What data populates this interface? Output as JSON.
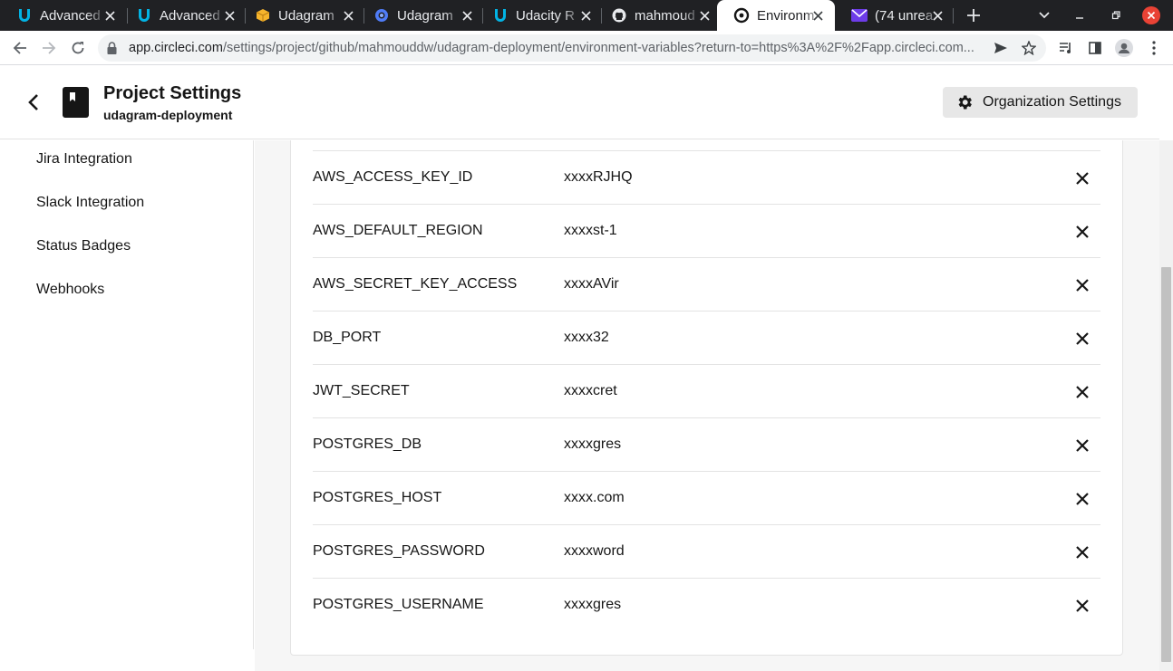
{
  "browser": {
    "tabs": [
      {
        "title": "Advanced",
        "icon": "udacity-icon"
      },
      {
        "title": "Advanced",
        "icon": "udacity-icon"
      },
      {
        "title": "Udagram",
        "icon": "aws-cube-icon"
      },
      {
        "title": "Udagram",
        "icon": "circle-app-icon"
      },
      {
        "title": "Udacity R",
        "icon": "udacity-icon"
      },
      {
        "title": "mahmoud",
        "icon": "github-icon"
      },
      {
        "title": "Environm",
        "icon": "circleci-icon",
        "active": true
      },
      {
        "title": "(74 unrea",
        "icon": "mail-icon"
      }
    ],
    "url_host": "app.circleci.com",
    "url_path": "/settings/project/github/mahmouddw/udagram-deployment/environment-variables?return-to=https%3A%2F%2Fapp.circleci.com..."
  },
  "header": {
    "title": "Project Settings",
    "subtitle": "udagram-deployment",
    "org_button": "Organization Settings"
  },
  "sidebar": {
    "items": [
      {
        "label": "Jira Integration"
      },
      {
        "label": "Slack Integration"
      },
      {
        "label": "Status Badges"
      },
      {
        "label": "Webhooks"
      }
    ]
  },
  "env_vars": [
    {
      "name": "AWS_ACCESS_KEY_ID",
      "value": "xxxxRJHQ"
    },
    {
      "name": "AWS_DEFAULT_REGION",
      "value": "xxxxst-1"
    },
    {
      "name": "AWS_SECRET_KEY_ACCESS",
      "value": "xxxxAVir"
    },
    {
      "name": "DB_PORT",
      "value": "xxxx32"
    },
    {
      "name": "JWT_SECRET",
      "value": "xxxxcret"
    },
    {
      "name": "POSTGRES_DB",
      "value": "xxxxgres"
    },
    {
      "name": "POSTGRES_HOST",
      "value": "xxxx.com"
    },
    {
      "name": "POSTGRES_PASSWORD",
      "value": "xxxxword"
    },
    {
      "name": "POSTGRES_USERNAME",
      "value": "xxxxgres"
    }
  ],
  "colors": {
    "tabstrip": "#202124",
    "text": "#161616",
    "close_red": "#e94235",
    "page_bg": "#f6f6f6"
  }
}
